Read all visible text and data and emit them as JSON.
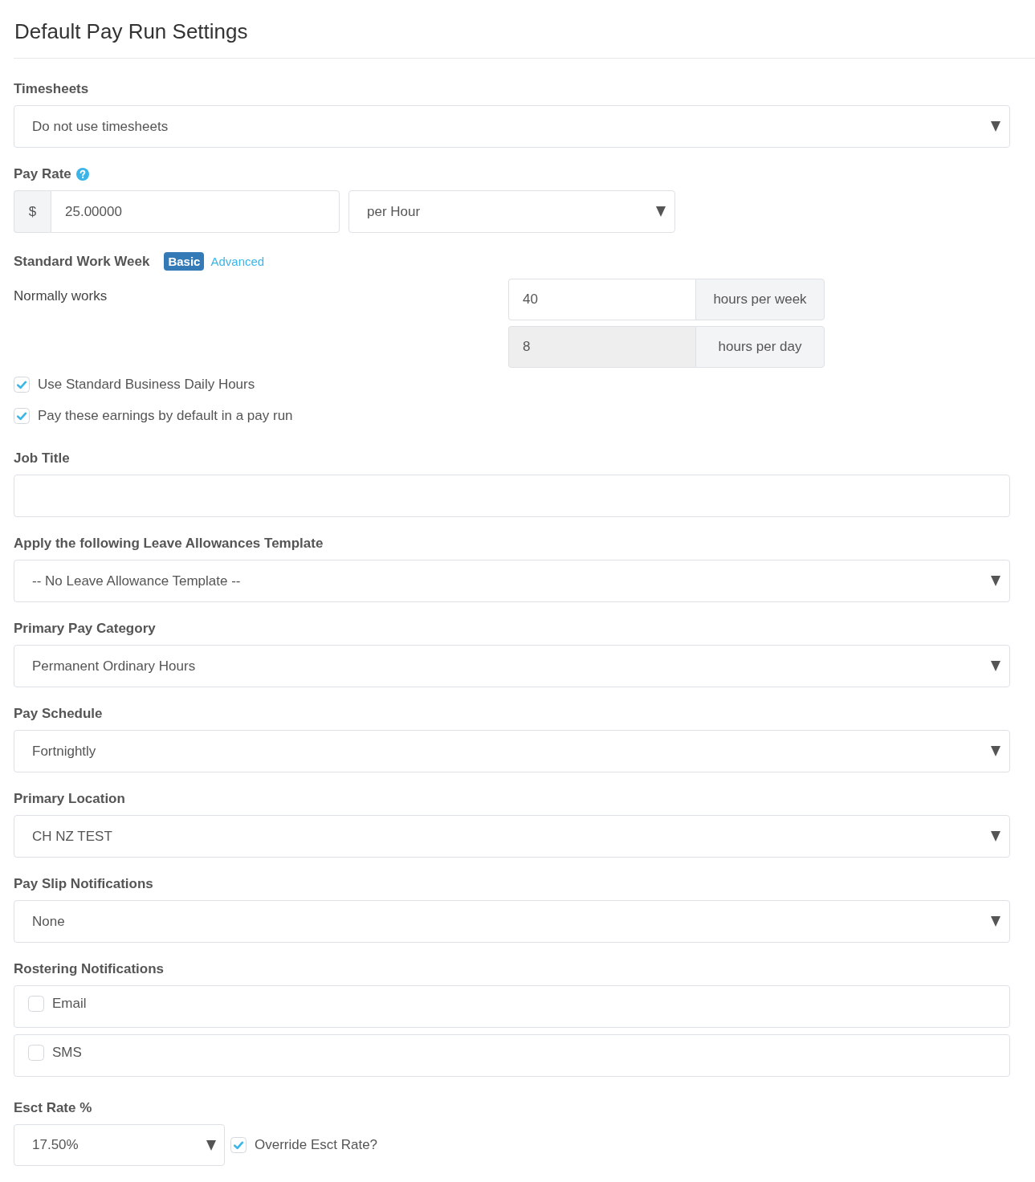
{
  "title": "Default Pay Run Settings",
  "timesheets": {
    "label": "Timesheets",
    "value": "Do not use timesheets"
  },
  "pay_rate": {
    "label": "Pay Rate",
    "currency": "$",
    "amount": "25.00000",
    "unit": "per Hour"
  },
  "work_week": {
    "label": "Standard Work Week",
    "modes": [
      {
        "label": "Basic",
        "selected": true
      },
      {
        "label": "Advanced",
        "selected": false
      }
    ],
    "caption": "Normally works",
    "rows": [
      {
        "value": "40",
        "unit": "hours per week",
        "disabled": false
      },
      {
        "value": "8",
        "unit": "hours per day",
        "disabled": true
      }
    ]
  },
  "options": [
    {
      "label": "Use Standard Business Daily Hours",
      "checked": true
    },
    {
      "label": "Pay these earnings by default in a pay run",
      "checked": true
    }
  ],
  "fields": [
    {
      "kind": "text",
      "label": "Job Title"
    },
    {
      "kind": "select",
      "label": "Apply the following Leave Allowances Template",
      "value": "-- No Leave Allowance Template --"
    },
    {
      "kind": "select",
      "label": "Primary Pay Category",
      "value": "Permanent Ordinary Hours"
    },
    {
      "kind": "select",
      "label": "Pay Schedule",
      "value": "Fortnightly"
    },
    {
      "kind": "select",
      "label": "Primary Location",
      "value": "CH NZ TEST"
    },
    {
      "kind": "select",
      "label": "Pay Slip Notifications",
      "value": "None"
    },
    {
      "kind": "checklist",
      "label": "Rostering Notifications",
      "options": [
        {
          "label": "Email",
          "checked": false
        },
        {
          "label": "SMS",
          "checked": false
        }
      ]
    }
  ],
  "esct": {
    "label": "Esct Rate %",
    "value": "17.50%",
    "override": {
      "label": "Override Esct Rate?",
      "checked": true
    }
  }
}
